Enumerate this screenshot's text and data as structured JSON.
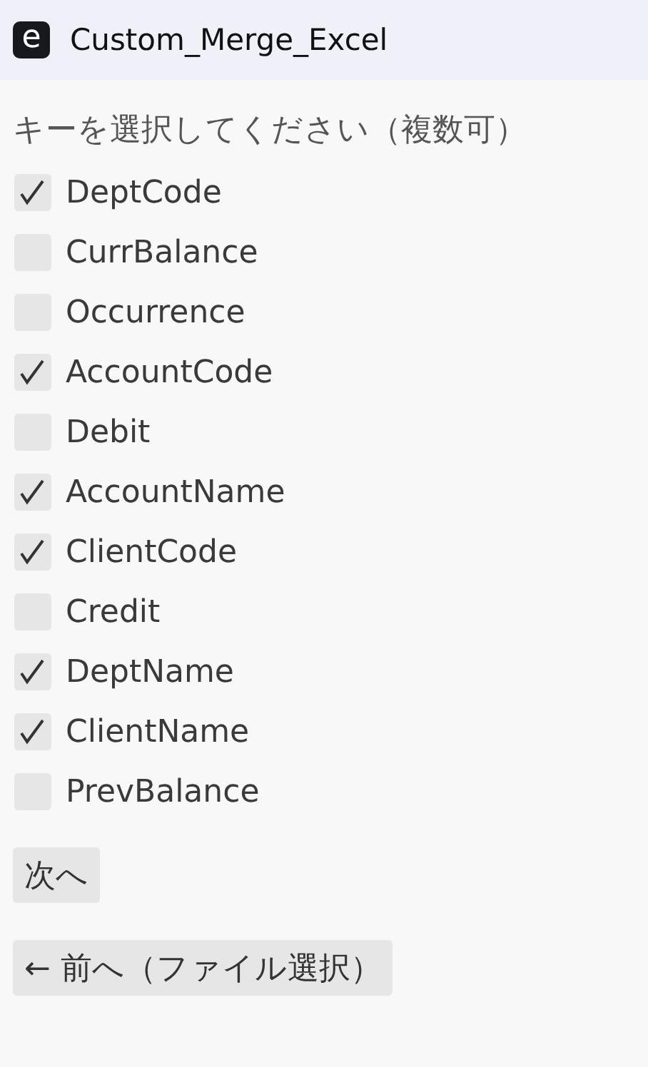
{
  "window": {
    "title": "Custom_Merge_Excel",
    "icon_letter": "e"
  },
  "heading": "キーを選択してください（複数可）",
  "keys": [
    {
      "label": "DeptCode",
      "checked": true
    },
    {
      "label": "CurrBalance",
      "checked": false
    },
    {
      "label": "Occurrence",
      "checked": false
    },
    {
      "label": "AccountCode",
      "checked": true
    },
    {
      "label": "Debit",
      "checked": false
    },
    {
      "label": "AccountName",
      "checked": true
    },
    {
      "label": "ClientCode",
      "checked": true
    },
    {
      "label": "Credit",
      "checked": false
    },
    {
      "label": "DeptName",
      "checked": true
    },
    {
      "label": "ClientName",
      "checked": true
    },
    {
      "label": "PrevBalance",
      "checked": false
    }
  ],
  "buttons": {
    "next": "次へ",
    "back": "← 前へ（ファイル選択）"
  }
}
